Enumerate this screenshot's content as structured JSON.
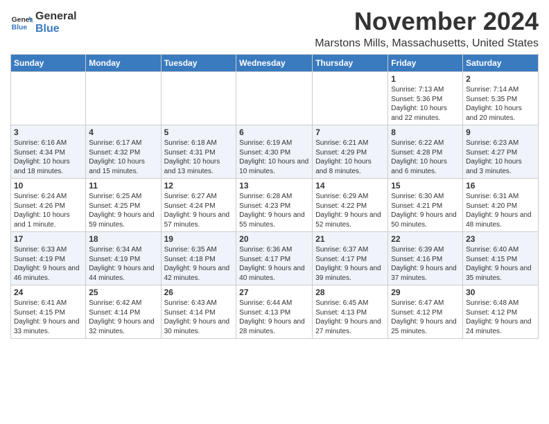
{
  "header": {
    "logo_general": "General",
    "logo_blue": "Blue",
    "month_title": "November 2024",
    "location": "Marstons Mills, Massachusetts, United States"
  },
  "days_of_week": [
    "Sunday",
    "Monday",
    "Tuesday",
    "Wednesday",
    "Thursday",
    "Friday",
    "Saturday"
  ],
  "weeks": [
    [
      {
        "day": "",
        "info": ""
      },
      {
        "day": "",
        "info": ""
      },
      {
        "day": "",
        "info": ""
      },
      {
        "day": "",
        "info": ""
      },
      {
        "day": "",
        "info": ""
      },
      {
        "day": "1",
        "info": "Sunrise: 7:13 AM\nSunset: 5:36 PM\nDaylight: 10 hours and 22 minutes."
      },
      {
        "day": "2",
        "info": "Sunrise: 7:14 AM\nSunset: 5:35 PM\nDaylight: 10 hours and 20 minutes."
      }
    ],
    [
      {
        "day": "3",
        "info": "Sunrise: 6:16 AM\nSunset: 4:34 PM\nDaylight: 10 hours and 18 minutes."
      },
      {
        "day": "4",
        "info": "Sunrise: 6:17 AM\nSunset: 4:32 PM\nDaylight: 10 hours and 15 minutes."
      },
      {
        "day": "5",
        "info": "Sunrise: 6:18 AM\nSunset: 4:31 PM\nDaylight: 10 hours and 13 minutes."
      },
      {
        "day": "6",
        "info": "Sunrise: 6:19 AM\nSunset: 4:30 PM\nDaylight: 10 hours and 10 minutes."
      },
      {
        "day": "7",
        "info": "Sunrise: 6:21 AM\nSunset: 4:29 PM\nDaylight: 10 hours and 8 minutes."
      },
      {
        "day": "8",
        "info": "Sunrise: 6:22 AM\nSunset: 4:28 PM\nDaylight: 10 hours and 6 minutes."
      },
      {
        "day": "9",
        "info": "Sunrise: 6:23 AM\nSunset: 4:27 PM\nDaylight: 10 hours and 3 minutes."
      }
    ],
    [
      {
        "day": "10",
        "info": "Sunrise: 6:24 AM\nSunset: 4:26 PM\nDaylight: 10 hours and 1 minute."
      },
      {
        "day": "11",
        "info": "Sunrise: 6:25 AM\nSunset: 4:25 PM\nDaylight: 9 hours and 59 minutes."
      },
      {
        "day": "12",
        "info": "Sunrise: 6:27 AM\nSunset: 4:24 PM\nDaylight: 9 hours and 57 minutes."
      },
      {
        "day": "13",
        "info": "Sunrise: 6:28 AM\nSunset: 4:23 PM\nDaylight: 9 hours and 55 minutes."
      },
      {
        "day": "14",
        "info": "Sunrise: 6:29 AM\nSunset: 4:22 PM\nDaylight: 9 hours and 52 minutes."
      },
      {
        "day": "15",
        "info": "Sunrise: 6:30 AM\nSunset: 4:21 PM\nDaylight: 9 hours and 50 minutes."
      },
      {
        "day": "16",
        "info": "Sunrise: 6:31 AM\nSunset: 4:20 PM\nDaylight: 9 hours and 48 minutes."
      }
    ],
    [
      {
        "day": "17",
        "info": "Sunrise: 6:33 AM\nSunset: 4:19 PM\nDaylight: 9 hours and 46 minutes."
      },
      {
        "day": "18",
        "info": "Sunrise: 6:34 AM\nSunset: 4:19 PM\nDaylight: 9 hours and 44 minutes."
      },
      {
        "day": "19",
        "info": "Sunrise: 6:35 AM\nSunset: 4:18 PM\nDaylight: 9 hours and 42 minutes."
      },
      {
        "day": "20",
        "info": "Sunrise: 6:36 AM\nSunset: 4:17 PM\nDaylight: 9 hours and 40 minutes."
      },
      {
        "day": "21",
        "info": "Sunrise: 6:37 AM\nSunset: 4:17 PM\nDaylight: 9 hours and 39 minutes."
      },
      {
        "day": "22",
        "info": "Sunrise: 6:39 AM\nSunset: 4:16 PM\nDaylight: 9 hours and 37 minutes."
      },
      {
        "day": "23",
        "info": "Sunrise: 6:40 AM\nSunset: 4:15 PM\nDaylight: 9 hours and 35 minutes."
      }
    ],
    [
      {
        "day": "24",
        "info": "Sunrise: 6:41 AM\nSunset: 4:15 PM\nDaylight: 9 hours and 33 minutes."
      },
      {
        "day": "25",
        "info": "Sunrise: 6:42 AM\nSunset: 4:14 PM\nDaylight: 9 hours and 32 minutes."
      },
      {
        "day": "26",
        "info": "Sunrise: 6:43 AM\nSunset: 4:14 PM\nDaylight: 9 hours and 30 minutes."
      },
      {
        "day": "27",
        "info": "Sunrise: 6:44 AM\nSunset: 4:13 PM\nDaylight: 9 hours and 28 minutes."
      },
      {
        "day": "28",
        "info": "Sunrise: 6:45 AM\nSunset: 4:13 PM\nDaylight: 9 hours and 27 minutes."
      },
      {
        "day": "29",
        "info": "Sunrise: 6:47 AM\nSunset: 4:12 PM\nDaylight: 9 hours and 25 minutes."
      },
      {
        "day": "30",
        "info": "Sunrise: 6:48 AM\nSunset: 4:12 PM\nDaylight: 9 hours and 24 minutes."
      }
    ]
  ]
}
